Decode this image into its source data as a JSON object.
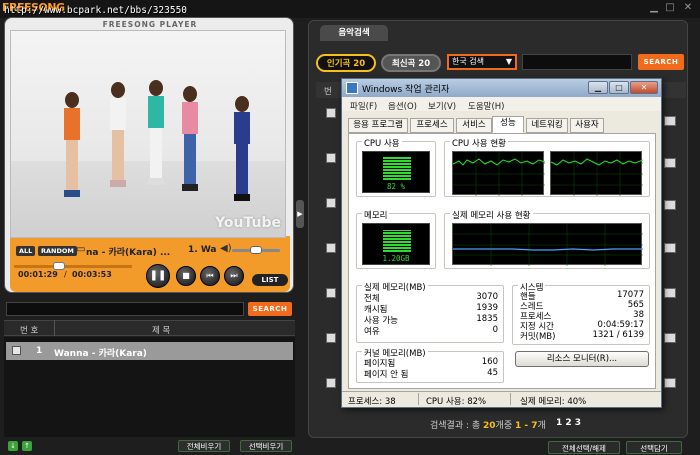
{
  "app": {
    "logo_text": "FREESONG",
    "watermark_url": "http://www.bcpark.net/bbs/323550"
  },
  "player": {
    "brand": "FREESONG PLAYER",
    "youtube_logo": "YouTube",
    "tag_all": "ALL",
    "tag_random": "RANDOM",
    "now_playing": "na - 카라(Kara) ...",
    "now_index": "1. Wa",
    "time_elapsed": "00:01:29",
    "time_sep": "/",
    "time_total": "00:03:53",
    "progress_fraction": 0.38,
    "volume_fraction": 0.5,
    "list_button": "LIST"
  },
  "left_search": {
    "search_button": "SEARCH"
  },
  "playlist": {
    "col_no": "번 호",
    "col_title": "제 목",
    "rows": [
      {
        "num": "1",
        "title": "Wanna - 카라(Kara)"
      }
    ],
    "clear_all": "전체비우기",
    "clear_selected": "선택비우기"
  },
  "right": {
    "tab_label": "음악검색",
    "pill_popular": "인기곡 20",
    "pill_latest": "최신곡 20",
    "dropdown_value": "한국 검색",
    "search_button": "SEARCH",
    "col_header_fragment": "번",
    "result_prefix": "검색결과 : 총 ",
    "result_total": "20",
    "result_mid": "개중 ",
    "result_range": "1 - 7",
    "result_suffix": "개",
    "pages": "1 2 3",
    "select_all": "전체선택/해제",
    "add_selected": "선택담기"
  },
  "taskmgr": {
    "title": "Windows 작업 관리자",
    "menus": [
      "파일(F)",
      "옵션(O)",
      "보기(V)",
      "도움말(H)"
    ],
    "tabs": [
      "응용 프로그램",
      "프로세스",
      "서비스",
      "성능",
      "네트워킹",
      "사용자"
    ],
    "active_tab": "성능",
    "cpu_usage_label": "CPU 사용",
    "cpu_usage_value": "82 %",
    "cpu_history_label": "CPU 사용 현황",
    "mem_label": "메모리",
    "mem_value": "1.20GB",
    "mem_history_label": "실제 메모리 사용 현황",
    "physical_mem": {
      "title": "실제 메모리(MB)",
      "rows": [
        {
          "label": "전체",
          "value": "3070"
        },
        {
          "label": "캐시됨",
          "value": "1939"
        },
        {
          "label": "사용 가능",
          "value": "1835"
        },
        {
          "label": "여유",
          "value": "0"
        }
      ]
    },
    "system": {
      "title": "시스템",
      "rows": [
        {
          "label": "핸들",
          "value": "17077"
        },
        {
          "label": "스레드",
          "value": "565"
        },
        {
          "label": "프로세스",
          "value": "38"
        },
        {
          "label": "지정 시간",
          "value": "0:04:59:17"
        },
        {
          "label": "커밋(MB)",
          "value": "1321 / 6139"
        }
      ]
    },
    "kernel_mem": {
      "title": "커널 메모리(MB)",
      "rows": [
        {
          "label": "페이지됨",
          "value": "160"
        },
        {
          "label": "페이지 안 됨",
          "value": "45"
        }
      ]
    },
    "resource_monitor_button": "리소스 모니터(R)...",
    "status_processes": "프로세스: 38",
    "status_cpu": "CPU 사용: 82%",
    "status_mem": "실제 메모리: 40%",
    "cpu_meter_fraction": 0.82,
    "mem_meter_fraction": 0.4
  }
}
